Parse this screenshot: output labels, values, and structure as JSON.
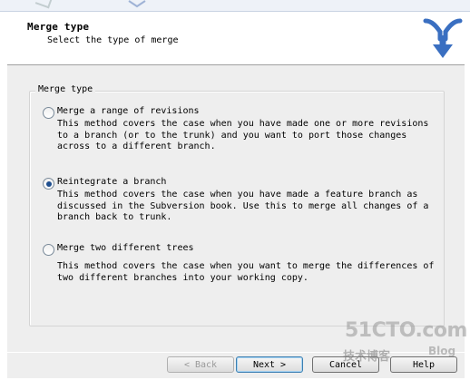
{
  "header": {
    "title": "Merge type",
    "subtitle": "Select the type of merge",
    "logo_icon": "tortoisesvn-merge-logo-icon",
    "logo_color": "#3a6fc1"
  },
  "group": {
    "legend": "Merge type",
    "options": [
      {
        "label": "Merge a range of revisions",
        "checked": false,
        "description": "This method covers the case when you have made one or more revisions\nto a branch (or to the trunk) and you want to port those changes\nacross to a different branch."
      },
      {
        "label": "Reintegrate a branch",
        "checked": true,
        "description": "This method covers the case when you have made a feature branch as\ndiscussed in the Subversion book. Use this to merge all changes of a\nbranch back to trunk."
      },
      {
        "label": "Merge two different trees",
        "checked": false,
        "description": "This method covers the case when you want to merge the differences of\ntwo different branches into your working copy."
      }
    ]
  },
  "buttons": {
    "back": "< Back",
    "next": "Next >",
    "cancel": "Cancel",
    "help": "Help"
  },
  "watermark": {
    "main": "51CTO.com",
    "sub": "技术博客",
    "blog": "Blog"
  }
}
